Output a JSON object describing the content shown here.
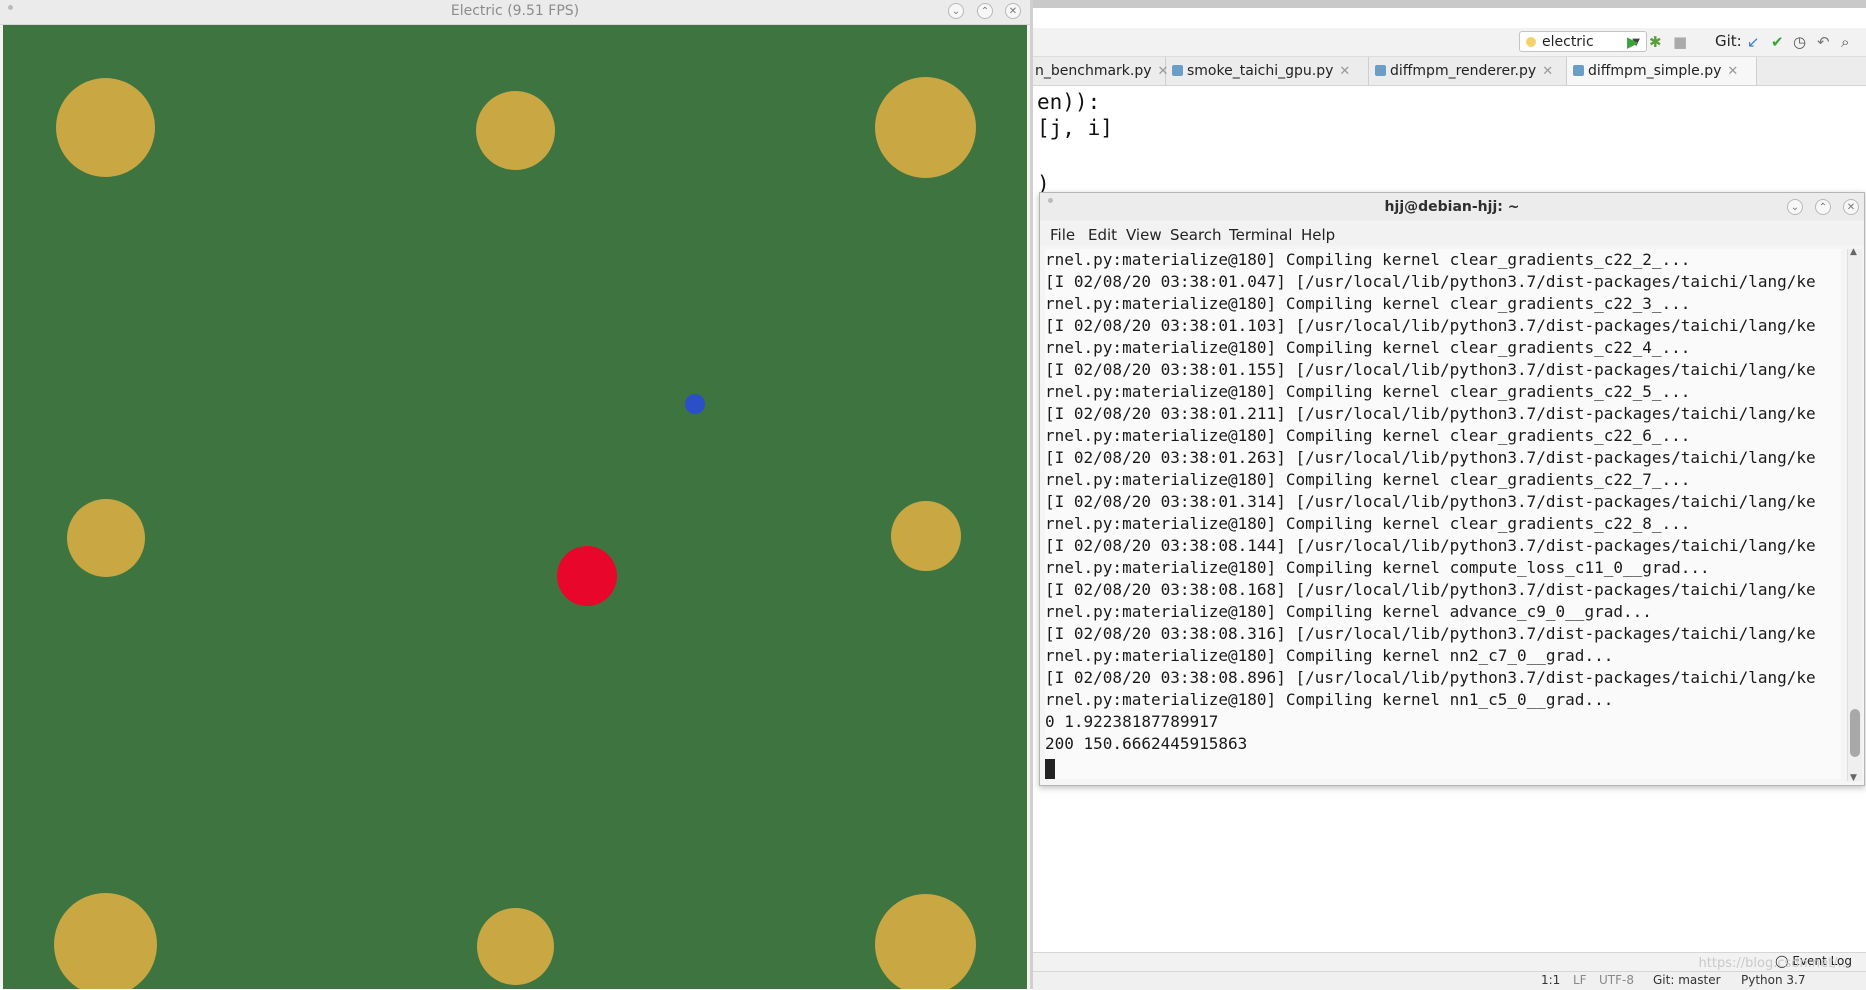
{
  "electric_window": {
    "title": "Electric (9.51 FPS)",
    "colors": {
      "background": "#3e7440",
      "pole": "#c9a843",
      "goal": "#2b4fc9",
      "particle": "#e8062b"
    }
  },
  "ide": {
    "run_config": "electric",
    "git_label": "Git:",
    "tabs": [
      {
        "label": "n_benchmark.py"
      },
      {
        "label": "smoke_taichi_gpu.py"
      },
      {
        "label": "diffmpm_renderer.py"
      },
      {
        "label": "diffmpm_simple.py"
      }
    ],
    "code_lines": [
      "en)):",
      "[j, i]",
      ")"
    ],
    "event_log": "Event Log",
    "status": {
      "position": "1:1",
      "line_ending": "LF",
      "encoding": "UTF-8",
      "git": "Git: master",
      "interpreter": "Python 3.7"
    }
  },
  "terminal": {
    "title": "hjj@debian-hjj: ~",
    "menu": [
      "File",
      "Edit",
      "View",
      "Search",
      "Terminal",
      "Help"
    ],
    "lines": [
      "rnel.py:materialize@180] Compiling kernel clear_gradients_c22_2_...",
      "[I 02/08/20 03:38:01.047] [/usr/local/lib/python3.7/dist-packages/taichi/lang/ke",
      "rnel.py:materialize@180] Compiling kernel clear_gradients_c22_3_...",
      "[I 02/08/20 03:38:01.103] [/usr/local/lib/python3.7/dist-packages/taichi/lang/ke",
      "rnel.py:materialize@180] Compiling kernel clear_gradients_c22_4_...",
      "[I 02/08/20 03:38:01.155] [/usr/local/lib/python3.7/dist-packages/taichi/lang/ke",
      "rnel.py:materialize@180] Compiling kernel clear_gradients_c22_5_...",
      "[I 02/08/20 03:38:01.211] [/usr/local/lib/python3.7/dist-packages/taichi/lang/ke",
      "rnel.py:materialize@180] Compiling kernel clear_gradients_c22_6_...",
      "[I 02/08/20 03:38:01.263] [/usr/local/lib/python3.7/dist-packages/taichi/lang/ke",
      "rnel.py:materialize@180] Compiling kernel clear_gradients_c22_7_...",
      "[I 02/08/20 03:38:01.314] [/usr/local/lib/python3.7/dist-packages/taichi/lang/ke",
      "rnel.py:materialize@180] Compiling kernel clear_gradients_c22_8_...",
      "[I 02/08/20 03:38:08.144] [/usr/local/lib/python3.7/dist-packages/taichi/lang/ke",
      "rnel.py:materialize@180] Compiling kernel compute_loss_c11_0__grad...",
      "[I 02/08/20 03:38:08.168] [/usr/local/lib/python3.7/dist-packages/taichi/lang/ke",
      "rnel.py:materialize@180] Compiling kernel advance_c9_0__grad...",
      "[I 02/08/20 03:38:08.316] [/usr/local/lib/python3.7/dist-packages/taichi/lang/ke",
      "rnel.py:materialize@180] Compiling kernel nn2_c7_0__grad...",
      "[I 02/08/20 03:38:08.896] [/usr/local/lib/python3.7/dist-packages/taichi/lang/ke",
      "rnel.py:materialize@180] Compiling kernel nn1_c5_0__grad...",
      "0 1.92238187789917",
      "200 150.6662445915863"
    ]
  },
  "watermark": "https://blog.csdn.net/..."
}
